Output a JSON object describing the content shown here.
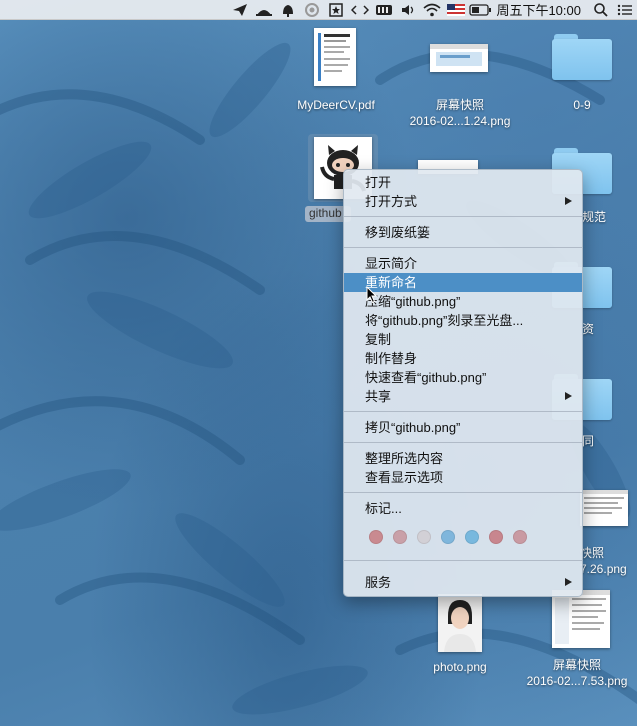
{
  "menubar": {
    "clock": "周五下午10:00",
    "icons": [
      "paper-plane-icon",
      "hat-icon",
      "bell-icon",
      "circle-app-icon",
      "star-box-icon",
      "code-icon",
      "battery-meter-icon",
      "volume-icon",
      "wifi-icon",
      "flag-icon",
      "battery-icon",
      "search-icon",
      "list-icon"
    ]
  },
  "desktop_icons": [
    {
      "label": "MyDeerCV.pdf"
    },
    {
      "label_line1": "屏幕快照",
      "label_line2": "2016-02...1.24.png"
    },
    {
      "label": "0-9"
    },
    {
      "label": "github"
    },
    {
      "label": "规范"
    },
    {
      "label": "资"
    },
    {
      "label": "同"
    },
    {
      "label_line1": "快照",
      "label_line2": "7.26.png"
    },
    {
      "label": "photo.png"
    },
    {
      "label_line1": "屏幕快照",
      "label_line2": "2016-02...7.53.png"
    }
  ],
  "context_menu": {
    "items": [
      {
        "label": "打开"
      },
      {
        "label": "打开方式",
        "submenu": true
      },
      {
        "label": "移到废纸篓"
      },
      {
        "label": "显示简介"
      },
      {
        "label": "重新命名",
        "highlighted": true
      },
      {
        "label": "压缩“github.png”"
      },
      {
        "label": "将“github.png”刻录至光盘..."
      },
      {
        "label": "复制"
      },
      {
        "label": "制作替身"
      },
      {
        "label": "快速查看“github.png”"
      },
      {
        "label": "共享",
        "submenu": true
      },
      {
        "label": "拷贝“github.png”"
      },
      {
        "label": "整理所选内容"
      },
      {
        "label": "查看显示选项"
      },
      {
        "label": "标记..."
      },
      {
        "label": "服务",
        "submenu": true
      }
    ],
    "tag_colors": [
      "#c98a90",
      "#c9a0a8",
      "#d2d0d6",
      "#7fb6dc",
      "#78b8de",
      "#c8868e",
      "#c99aa2"
    ]
  },
  "colors": {
    "highlight": "#4c8fc6",
    "folder": "#8fcbf0"
  }
}
